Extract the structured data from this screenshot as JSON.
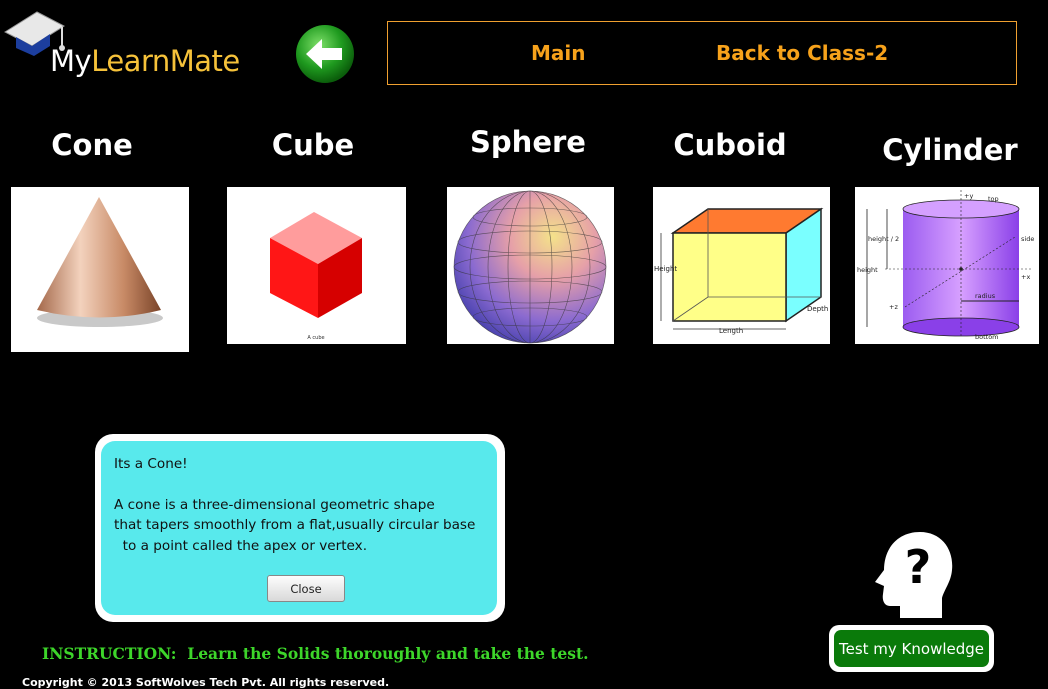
{
  "app": {
    "brand_part1": "My",
    "brand_part2": "LearnMate"
  },
  "nav": {
    "main_label": "Main",
    "back_label": "Back to Class-2"
  },
  "shapes": [
    {
      "title": "Cone"
    },
    {
      "title": "Cube",
      "image_caption": "A cube"
    },
    {
      "title": "Sphere"
    },
    {
      "title": "Cuboid",
      "labels": {
        "height": "Height",
        "length": "Length",
        "depth": "Depth"
      }
    },
    {
      "title": "Cylinder",
      "labels": {
        "top": "top",
        "side": "side",
        "height_half": "height / 2",
        "height": "height",
        "radius": "radius",
        "bottom": "bottom",
        "y_axis": "+y",
        "x_axis": "+x",
        "z_axis": "+z"
      }
    }
  ],
  "dialog": {
    "heading": "Its a Cone!",
    "line1": "A cone is a three-dimensional geometric shape",
    "line2": "that tapers smoothly from a flat,usually circular base",
    "line3": "  to a point called the apex or vertex.",
    "close_label": "Close"
  },
  "test_button_label": "Test my Knowledge",
  "instruction": "INSTRUCTION:  Learn the Solids thoroughly and take the test.",
  "copyright": "Copyright © 2013 SoftWolves Tech Pvt. All rights reserved.",
  "colors": {
    "nav_text": "#f7a21b",
    "instruction": "#3dd62a",
    "dialog_bg": "#58e9ec",
    "test_button": "#0a7a0a"
  },
  "icons": [
    "graduation-cap-icon",
    "back-arrow-icon",
    "question-head-icon"
  ]
}
